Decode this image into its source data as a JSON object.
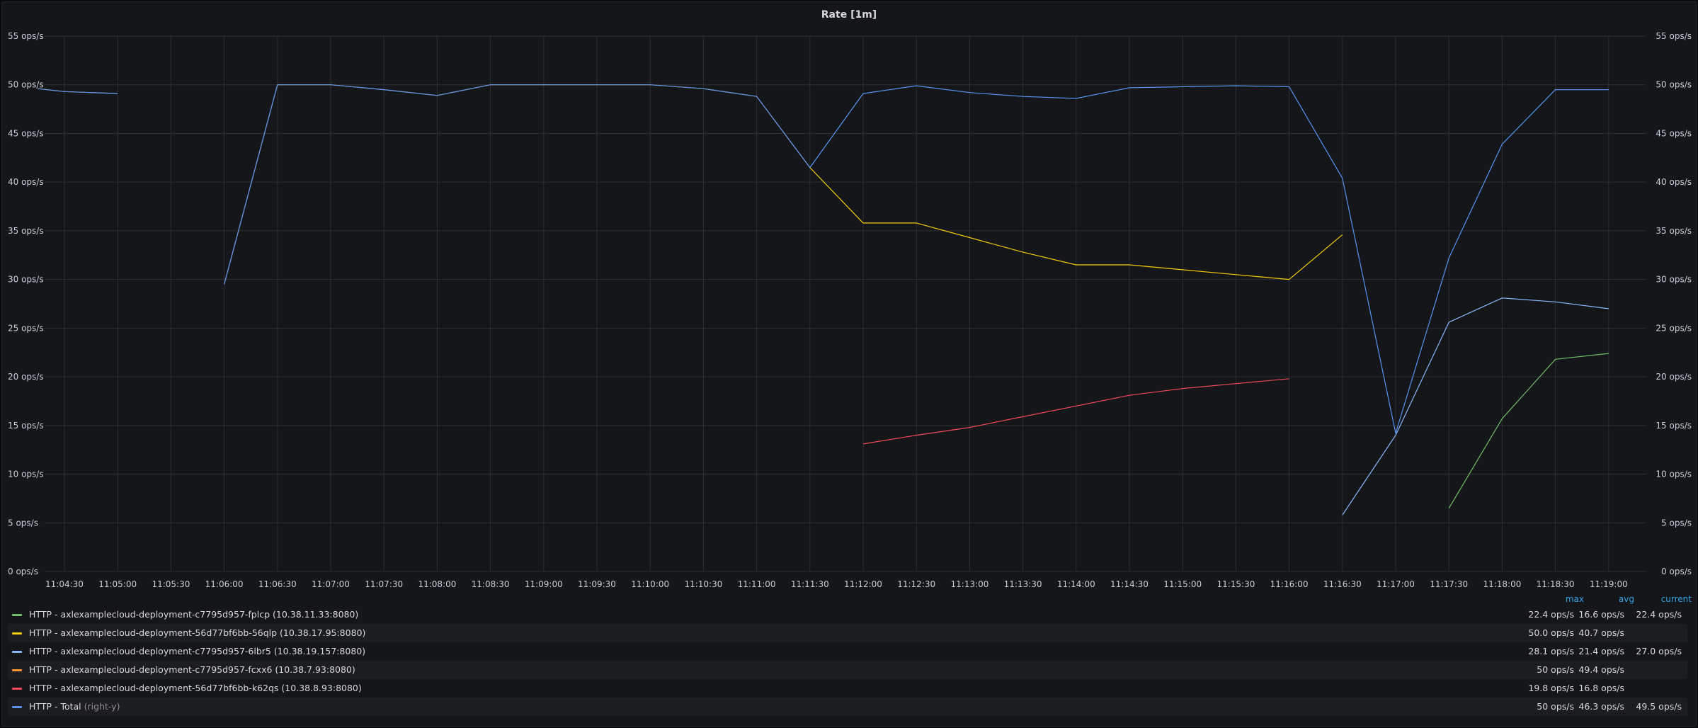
{
  "panel": {
    "title": "Rate [1m]"
  },
  "legend": {
    "columns": {
      "max": "max",
      "avg": "avg",
      "current": "current"
    }
  },
  "chart_data": {
    "type": "line",
    "title": "Rate [1m]",
    "xlabel": "",
    "ylabel": "",
    "ylim": [
      0,
      55
    ],
    "y_ticks": [
      "0 ops/s",
      "5 ops/s",
      "10 ops/s",
      "15 ops/s",
      "20 ops/s",
      "25 ops/s",
      "30 ops/s",
      "35 ops/s",
      "40 ops/s",
      "45 ops/s",
      "50 ops/s",
      "55 ops/s"
    ],
    "y2_ticks": [
      "0 ops/s",
      "5 ops/s",
      "10 ops/s",
      "15 ops/s",
      "20 ops/s",
      "25 ops/s",
      "30 ops/s",
      "35 ops/s",
      "40 ops/s",
      "45 ops/s",
      "50 ops/s",
      "55 ops/s"
    ],
    "x_ticks": [
      "11:04:30",
      "11:05:00",
      "11:05:30",
      "11:06:00",
      "11:06:30",
      "11:07:00",
      "11:07:30",
      "11:08:00",
      "11:08:30",
      "11:09:00",
      "11:09:30",
      "11:10:00",
      "11:10:30",
      "11:11:00",
      "11:11:30",
      "11:12:00",
      "11:12:30",
      "11:13:00",
      "11:13:30",
      "11:14:00",
      "11:14:30",
      "11:15:00",
      "11:15:30",
      "11:16:00",
      "11:16:30",
      "11:17:00",
      "11:17:30",
      "11:18:00",
      "11:18:30",
      "11:19:00"
    ],
    "grid": true,
    "legend_position": "bottom",
    "series": [
      {
        "name": "HTTP - axlexamplecloud-deployment-c7795d957-fplcp (10.38.11.33:8080)",
        "color": "#73bf69",
        "max": "22.4 ops/s",
        "avg": "16.6 ops/s",
        "current": "22.4 ops/s",
        "segments": [
          [
            [
              "11:17:30",
              6.5
            ],
            [
              "11:18:00",
              15.7
            ],
            [
              "11:18:30",
              21.8
            ],
            [
              "11:19:00",
              22.4
            ]
          ]
        ]
      },
      {
        "name": "HTTP - axlexamplecloud-deployment-56d77bf6bb-56qlp (10.38.17.95:8080)",
        "color": "#f2cc0c",
        "max": "50.0 ops/s",
        "avg": "40.7 ops/s",
        "current": "",
        "segments": [
          [
            [
              "11:11:30",
              41.5
            ],
            [
              "11:12:00",
              35.8
            ],
            [
              "11:12:30",
              35.8
            ],
            [
              "11:13:00",
              34.3
            ],
            [
              "11:13:30",
              32.8
            ],
            [
              "11:14:00",
              31.5
            ],
            [
              "11:14:30",
              31.5
            ],
            [
              "11:15:00",
              31.0
            ],
            [
              "11:15:30",
              30.5
            ],
            [
              "11:16:00",
              30.0
            ],
            [
              "11:16:30",
              34.6
            ]
          ]
        ]
      },
      {
        "name": "HTTP - axlexamplecloud-deployment-c7795d957-6lbr5 (10.38.19.157:8080)",
        "color": "#8ab8ff",
        "max": "28.1 ops/s",
        "avg": "21.4 ops/s",
        "current": "27.0 ops/s",
        "segments": [
          [
            [
              "11:16:30",
              5.8
            ],
            [
              "11:17:00",
              14.0
            ],
            [
              "11:17:30",
              25.6
            ],
            [
              "11:18:00",
              28.1
            ],
            [
              "11:18:30",
              27.7
            ],
            [
              "11:19:00",
              27.0
            ]
          ]
        ]
      },
      {
        "name": "HTTP - axlexamplecloud-deployment-c7795d957-fcxx6 (10.38.7.93:8080)",
        "color": "#ff9830",
        "max": "50 ops/s",
        "avg": "49.4 ops/s",
        "current": "",
        "segments": [
          [
            [
              "11:04:15",
              49.6
            ],
            [
              "11:04:30",
              49.3
            ],
            [
              "11:05:00",
              49.1
            ]
          ],
          [
            [
              "11:06:00",
              29.5
            ],
            [
              "11:06:30",
              50.0
            ],
            [
              "11:07:00",
              50.0
            ],
            [
              "11:07:30",
              49.5
            ],
            [
              "11:08:00",
              48.9
            ],
            [
              "11:08:30",
              50.0
            ],
            [
              "11:09:00",
              50.0
            ],
            [
              "11:09:30",
              50.0
            ],
            [
              "11:10:00",
              50.0
            ],
            [
              "11:10:30",
              49.6
            ],
            [
              "11:11:00",
              48.8
            ],
            [
              "11:11:30",
              41.5
            ]
          ]
        ]
      },
      {
        "name": "HTTP - axlexamplecloud-deployment-56d77bf6bb-k62qs (10.38.8.93:8080)",
        "color": "#f2495c",
        "max": "19.8 ops/s",
        "avg": "16.8 ops/s",
        "current": "",
        "segments": [
          [
            [
              "11:12:00",
              13.1
            ],
            [
              "11:12:30",
              14.0
            ],
            [
              "11:13:00",
              14.8
            ],
            [
              "11:13:30",
              15.9
            ],
            [
              "11:14:00",
              17.0
            ],
            [
              "11:14:30",
              18.1
            ],
            [
              "11:15:00",
              18.8
            ],
            [
              "11:15:30",
              19.3
            ],
            [
              "11:16:00",
              19.8
            ]
          ]
        ]
      },
      {
        "name": "HTTP - Total",
        "axis_note": "(right-y)",
        "color": "#5794f2",
        "max": "50 ops/s",
        "avg": "46.3 ops/s",
        "current": "49.5 ops/s",
        "segments": [
          [
            [
              "11:04:15",
              49.6
            ],
            [
              "11:04:30",
              49.3
            ],
            [
              "11:05:00",
              49.1
            ]
          ],
          [
            [
              "11:06:00",
              29.5
            ],
            [
              "11:06:30",
              50.0
            ],
            [
              "11:07:00",
              50.0
            ],
            [
              "11:07:30",
              49.5
            ],
            [
              "11:08:00",
              48.9
            ],
            [
              "11:08:30",
              50.0
            ],
            [
              "11:09:00",
              50.0
            ],
            [
              "11:09:30",
              50.0
            ],
            [
              "11:10:00",
              50.0
            ],
            [
              "11:10:30",
              49.6
            ],
            [
              "11:11:00",
              48.8
            ],
            [
              "11:11:30",
              41.5
            ],
            [
              "11:12:00",
              49.1
            ],
            [
              "11:12:30",
              49.9
            ],
            [
              "11:13:00",
              49.2
            ],
            [
              "11:13:30",
              48.8
            ],
            [
              "11:14:00",
              48.6
            ],
            [
              "11:14:30",
              49.7
            ],
            [
              "11:15:00",
              49.8
            ],
            [
              "11:15:30",
              49.9
            ],
            [
              "11:16:00",
              49.8
            ],
            [
              "11:16:30",
              40.4
            ],
            [
              "11:17:00",
              14.2
            ],
            [
              "11:17:30",
              32.2
            ],
            [
              "11:18:00",
              43.9
            ],
            [
              "11:18:30",
              49.5
            ],
            [
              "11:19:00",
              49.5
            ]
          ]
        ]
      }
    ]
  }
}
